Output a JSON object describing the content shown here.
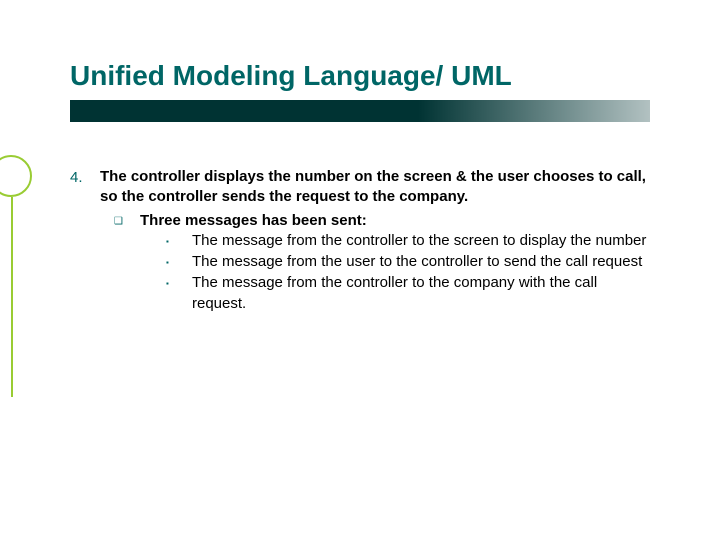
{
  "title": "Unified Modeling Language/ UML",
  "list": {
    "number": "4.",
    "text": "The controller displays the number on the screen & the user chooses to call, so the controller sends the request to the company.",
    "sub": {
      "text": "Three messages has been sent:",
      "items": [
        "The message from the controller to the screen to display the number",
        "The message from the user to the controller to send the call request",
        "The message from the controller to the company with the call request."
      ]
    }
  }
}
